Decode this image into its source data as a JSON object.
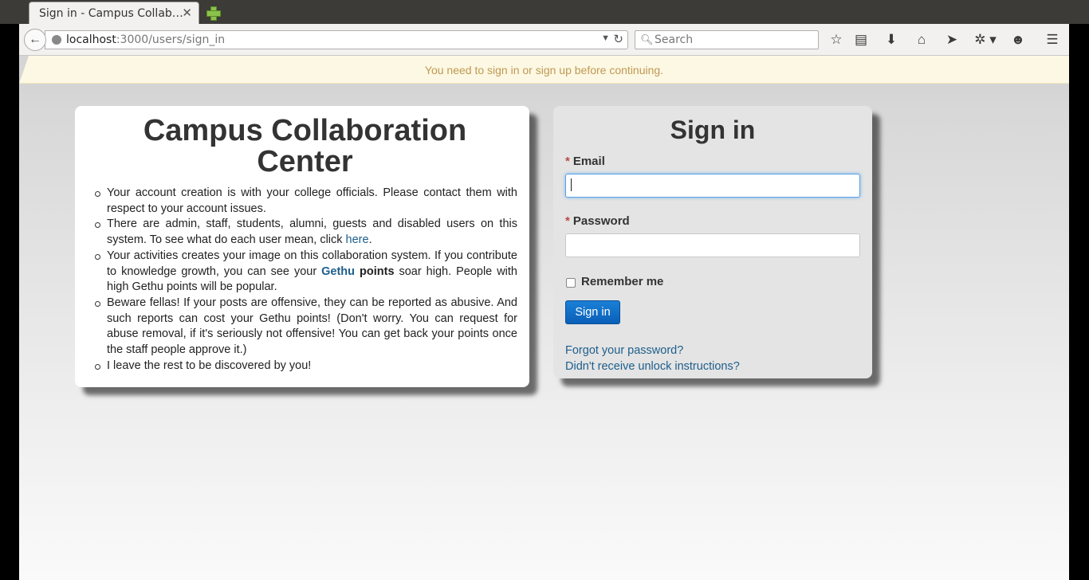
{
  "browser": {
    "tab_title": "Sign in - Campus Collab…",
    "tab_close": "✕",
    "url_host": "localhost",
    "url_path": ":3000/users/sign_in",
    "search_placeholder": "Search",
    "toolbar_icons": [
      "bookmark-star-icon",
      "reading-list-icon",
      "download-icon",
      "home-icon",
      "send-icon",
      "extension-icon",
      "chat-icon",
      "menu-icon"
    ]
  },
  "flash": {
    "message": "You need to sign in or sign up before continuing."
  },
  "info": {
    "title": "Campus Collaboration Center",
    "items": [
      {
        "text": "Your account creation is with your college officials. Please contact them with respect to your account issues."
      },
      {
        "pre": "There are admin, staff, students, alumni, guests and disabled users on this system. To see what do each user mean, click ",
        "link": "here",
        "post": "."
      },
      {
        "pre": "Your activities creates your image on this collaboration system. If you contribute to knowledge growth, you can see your ",
        "bold_link": "Gethu",
        "bold": "points",
        "post": " soar high. People with high Gethu points will be popular."
      },
      {
        "text": "Beware fellas! If your posts are offensive, they can be reported as abusive. And such reports can cost your Gethu points! (Don't worry. You can request for abuse removal, if it's seriously not offensive! You can get back your points once the staff people approve it.)"
      },
      {
        "text": "I leave the rest to be discovered by you!"
      }
    ]
  },
  "signin": {
    "title": "Sign in",
    "required_marker": "*",
    "email_label": "Email",
    "email_value": "",
    "password_label": "Password",
    "password_value": "",
    "remember_label": "Remember me",
    "remember_checked": false,
    "submit_label": "Sign in",
    "forgot_link": "Forgot your password?",
    "unlock_link": "Didn't receive unlock instructions?"
  }
}
